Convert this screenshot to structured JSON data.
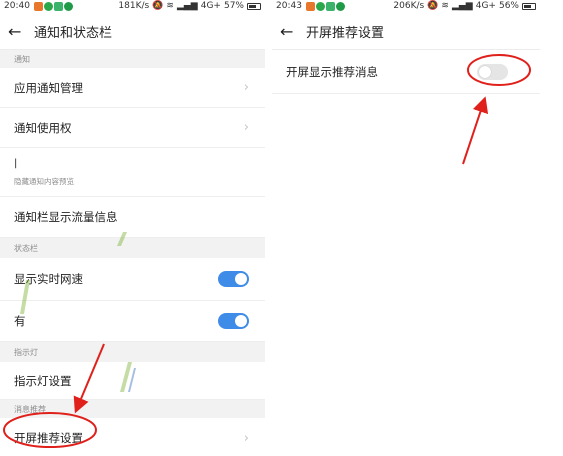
{
  "left": {
    "status": {
      "time": "20:40",
      "speed": "181K/s",
      "network": "4G+",
      "battery": "57%"
    },
    "title": "通知和状态栏",
    "sections": {
      "notify": "通知",
      "statusbar": "状态栏",
      "indicator": "指示灯",
      "recommend": "消息推荐"
    },
    "rows": {
      "app_notify": "应用通知管理",
      "notify_access": "通知使用权",
      "hidden_item": "|",
      "hidden_sub": "隐藏通知内容预览",
      "traffic": "通知栏显示流量信息",
      "net_speed": "显示实时网速",
      "partial": "有",
      "indicator_setting": "指示灯设置",
      "splash_setting": "开屏推荐设置"
    },
    "toggles": {
      "net_speed": true,
      "partial": true
    }
  },
  "right": {
    "status": {
      "time": "20:43",
      "speed": "206K/s",
      "network": "4G+",
      "battery": "56%"
    },
    "title": "开屏推荐设置",
    "rows": {
      "splash_msg": "开屏显示推荐消息"
    },
    "toggles": {
      "splash_msg": false
    }
  },
  "icons": {
    "back": "arrow-left-icon",
    "chevron": "chevron-right-icon"
  },
  "colors": {
    "toggle_on": "#3f8ce8",
    "annotation": "#e0201b"
  }
}
